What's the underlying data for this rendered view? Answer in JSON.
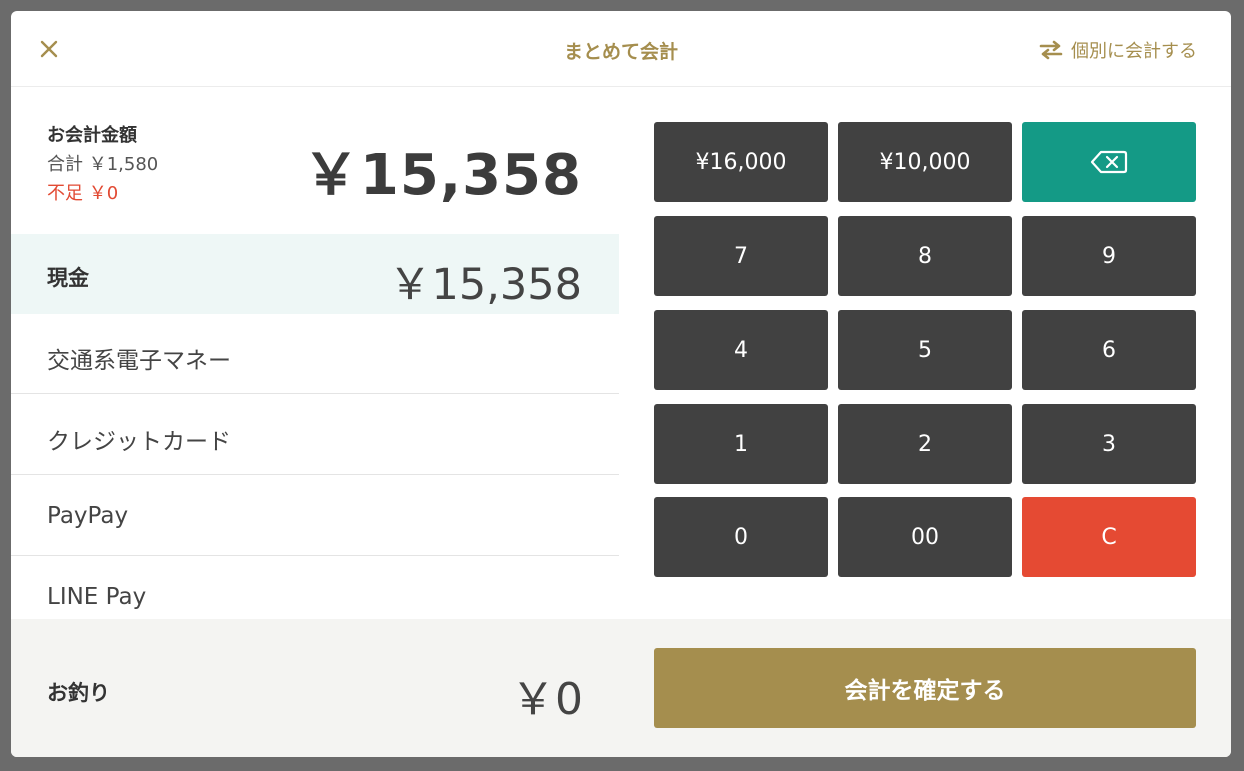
{
  "header": {
    "title": "まとめて会計",
    "split_label": "個別に会計する"
  },
  "summary": {
    "label": "お会計金額",
    "subtotal": "合計 ￥1,580",
    "shortage": "不足 ￥0",
    "total": "￥15,358"
  },
  "methods": [
    {
      "label": "現金",
      "amount": "￥15,358",
      "selected": true
    },
    {
      "label": "交通系電子マネー",
      "amount": ""
    },
    {
      "label": "クレジットカード",
      "amount": ""
    },
    {
      "label": "PayPay",
      "amount": ""
    },
    {
      "label": "LINE Pay",
      "amount": ""
    }
  ],
  "keypad": {
    "quick1": "¥16,000",
    "quick2": "¥10,000",
    "k7": "7",
    "k8": "8",
    "k9": "9",
    "k4": "4",
    "k5": "5",
    "k6": "6",
    "k1": "1",
    "k2": "2",
    "k3": "3",
    "k0": "0",
    "k00": "00",
    "clear": "C"
  },
  "footer": {
    "change_label": "お釣り",
    "change_amount": "￥0",
    "confirm_label": "会計を確定する"
  },
  "colors": {
    "accent_gold": "#a58e4e",
    "teal": "#149a86",
    "red": "#e54a33",
    "key_dark": "#414141"
  },
  "icons": {
    "close": "close-icon",
    "split": "swap-arrows-icon",
    "backspace": "backspace-icon"
  }
}
